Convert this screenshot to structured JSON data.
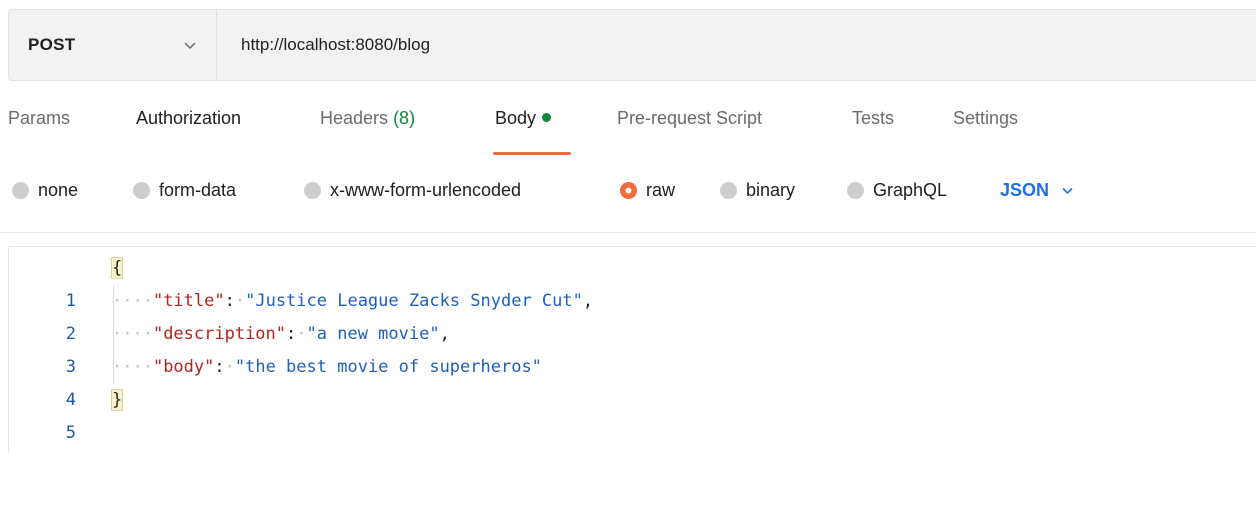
{
  "request": {
    "method": "POST",
    "url": "http://localhost:8080/blog"
  },
  "tabs": [
    {
      "label": "Params"
    },
    {
      "label": "Authorization"
    },
    {
      "label": "Headers",
      "count": "(8)"
    },
    {
      "label": "Body",
      "active": true
    },
    {
      "label": "Pre-request Script"
    },
    {
      "label": "Tests"
    },
    {
      "label": "Settings"
    }
  ],
  "body_options": [
    {
      "label": "none",
      "selected": false
    },
    {
      "label": "form-data",
      "selected": false
    },
    {
      "label": "x-www-form-urlencoded",
      "selected": false
    },
    {
      "label": "raw",
      "selected": true
    },
    {
      "label": "binary",
      "selected": false
    },
    {
      "label": "GraphQL",
      "selected": false
    }
  ],
  "language": "JSON",
  "editor": {
    "line_numbers": [
      "1",
      "2",
      "3",
      "4",
      "5"
    ],
    "open_brace": "{",
    "close_brace": "}",
    "indent": "····",
    "fields": [
      {
        "key": "\"title\"",
        "value": "\"Justice League Zacks Snyder Cut\"",
        "trailing": ","
      },
      {
        "key": "\"description\"",
        "value": "\"a new movie\"",
        "trailing": ","
      },
      {
        "key": "\"body\"",
        "value": "\"the best movie of superheros\"",
        "trailing": ""
      }
    ]
  },
  "colors": {
    "accent_orange": "#f26b3a",
    "active_dot_green": "#0f8a3c",
    "json_key_red": "#b3231f",
    "json_string_blue": "#1f5fbf",
    "language_blue": "#1f6fe5"
  }
}
